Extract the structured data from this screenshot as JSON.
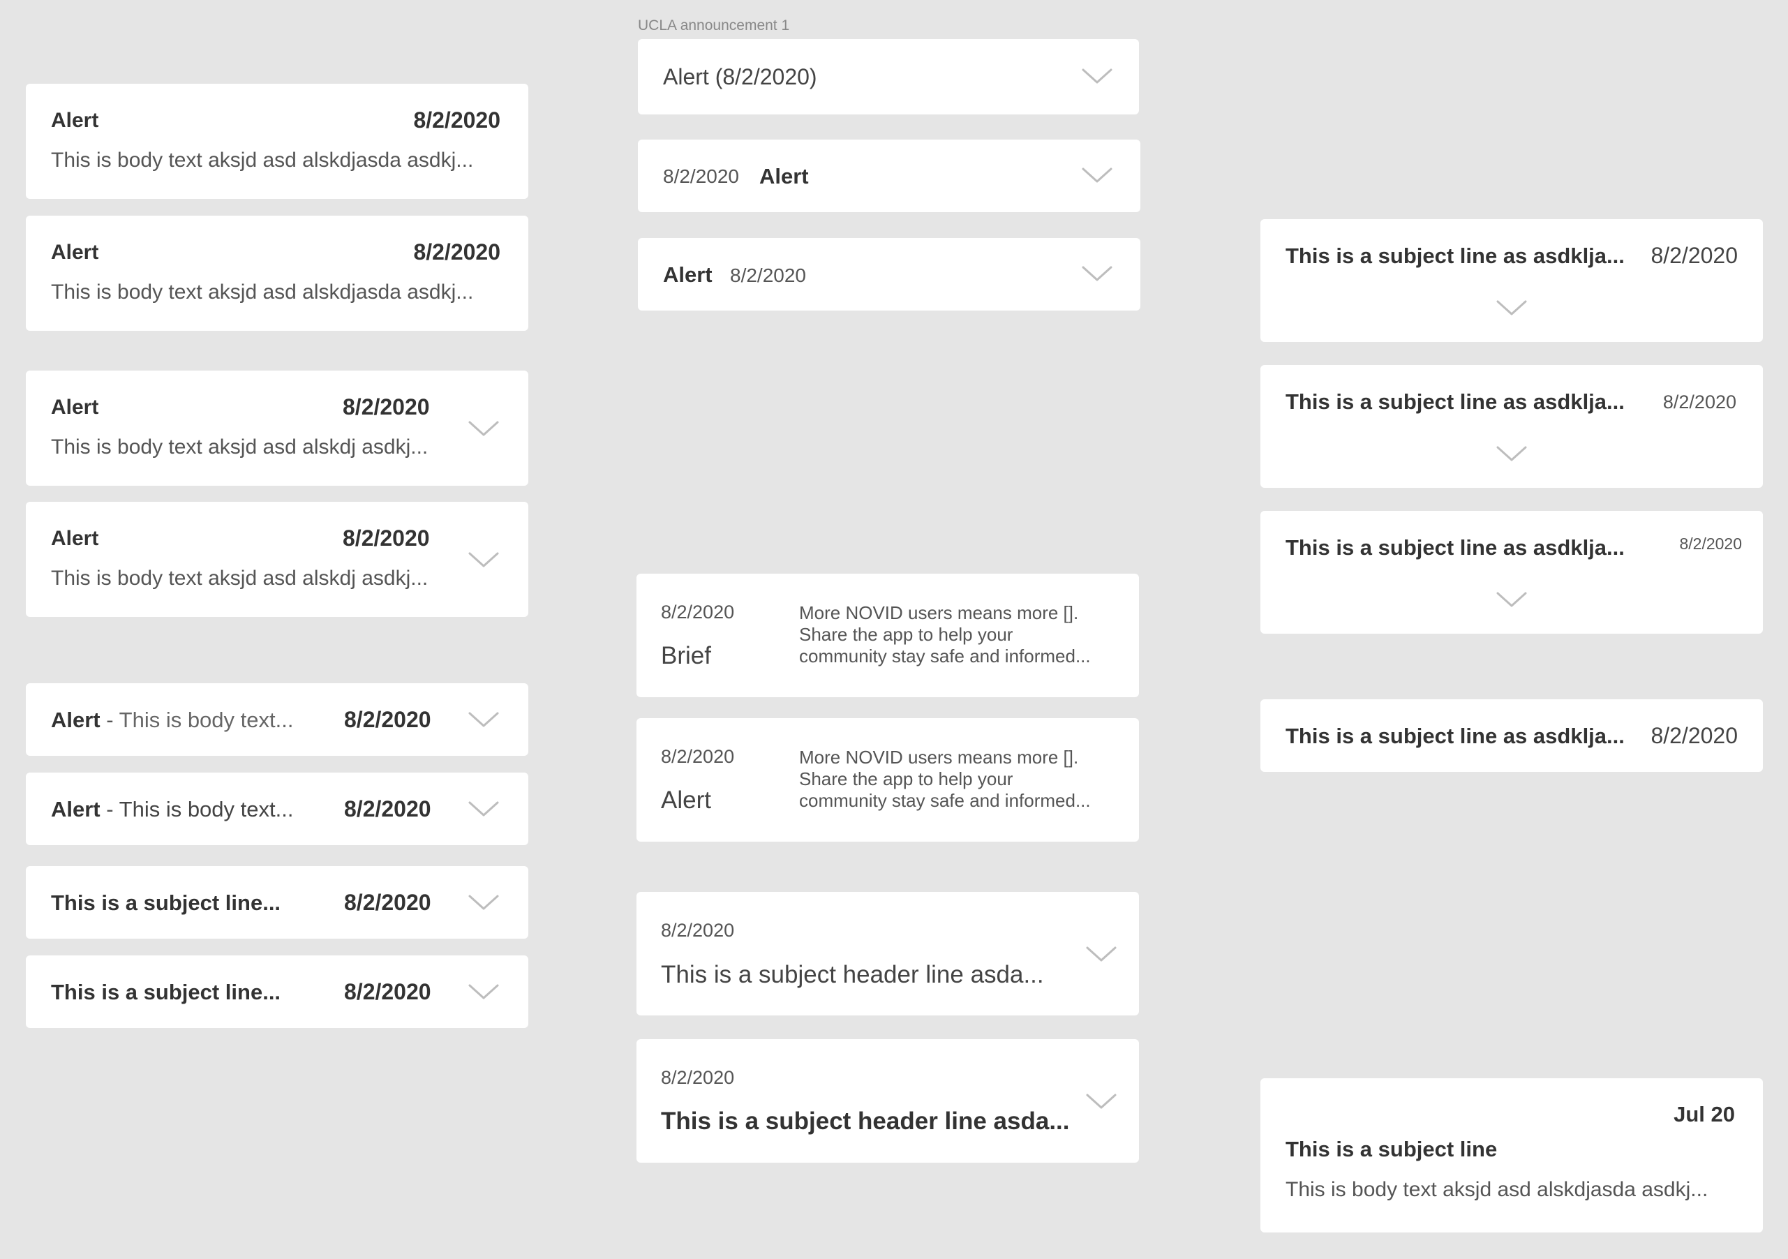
{
  "frame_label": "UCLA announcement 1",
  "icons": {
    "chevron": "chevron-down-icon"
  },
  "left_column": {
    "cards_body": [
      {
        "title": "Alert",
        "date": "8/2/2020",
        "body": "This is body text aksjd asd alskdjasda asdkj..."
      },
      {
        "title": "Alert",
        "date": "8/2/2020",
        "body": "This is body text aksjd asd alskdjasda asdkj..."
      }
    ],
    "cards_body_chevron": [
      {
        "title": "Alert",
        "date": "8/2/2020",
        "body": "This is body text aksjd asd alskdj asdkj..."
      },
      {
        "title": "Alert",
        "date": "8/2/2020",
        "body": "This is body text aksjd asd alskdj asdkj..."
      }
    ],
    "rows_inline": [
      {
        "title": "Alert",
        "separator": " - ",
        "body": "This is body text...",
        "date": "8/2/2020"
      },
      {
        "title": "Alert",
        "separator": " - ",
        "body": "This is body text...",
        "date": "8/2/2020"
      }
    ],
    "rows_subject": [
      {
        "subject": "This is a subject line...",
        "date": "8/2/2020"
      },
      {
        "subject": "This is a subject line...",
        "date": "8/2/2020"
      }
    ]
  },
  "middle_column": {
    "collapsed": [
      {
        "title": "Alert (8/2/2020)"
      },
      {
        "date": "8/2/2020",
        "title": "Alert"
      },
      {
        "title": "Alert",
        "date": "8/2/2020"
      }
    ],
    "briefs": [
      {
        "date": "8/2/2020",
        "label": "Brief",
        "body": [
          "More NOVID users means more [].",
          "Share the app to help your",
          "community stay safe and informed..."
        ]
      },
      {
        "date": "8/2/2020",
        "label": "Alert",
        "body": [
          "More NOVID users means more [].",
          "Share the app to help your",
          "community stay safe and informed..."
        ]
      }
    ],
    "headers": [
      {
        "date": "8/2/2020",
        "subject": "This is a subject header line asda..."
      },
      {
        "date": "8/2/2020",
        "subject": "This is a subject header line asda..."
      }
    ]
  },
  "right_column": {
    "subject_chevron": [
      {
        "subject": "This is a subject line as asdklja...",
        "date": "8/2/2020"
      },
      {
        "subject": "This is a subject line as asdklja...",
        "date": "8/2/2020"
      },
      {
        "subject": "This is a subject line as asdklja...",
        "date": "8/2/2020"
      }
    ],
    "subject_only": {
      "subject": "This is a subject line as asdklja...",
      "date": "8/2/2020"
    },
    "full_card": {
      "date": "Jul 20",
      "subject": "This is a subject line",
      "body": "This is body text aksjd asd alskdjasda asdkj..."
    }
  }
}
